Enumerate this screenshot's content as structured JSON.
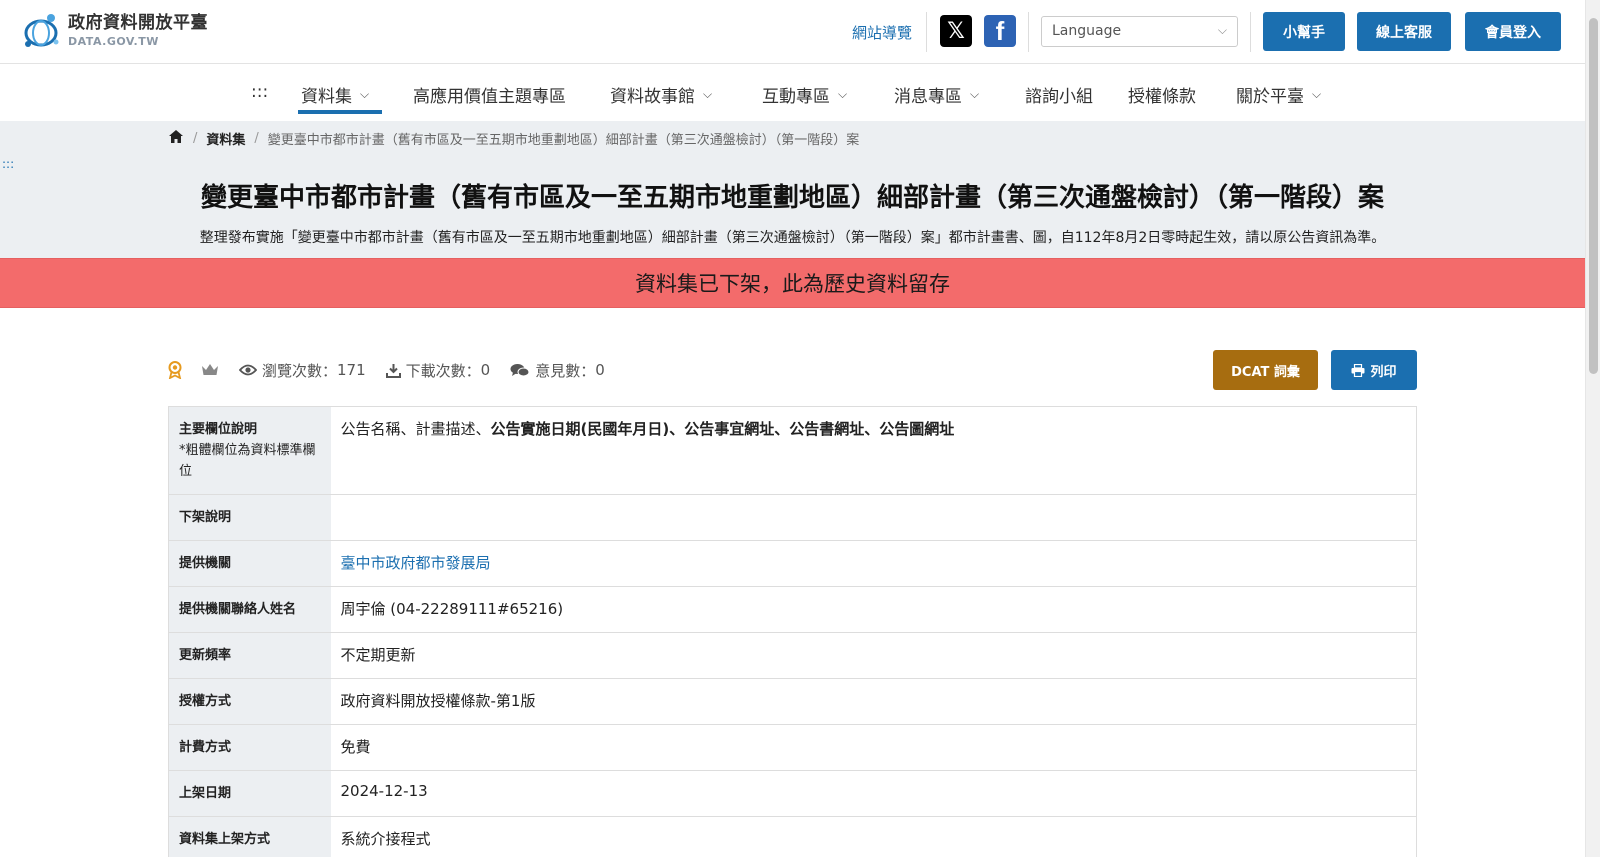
{
  "header": {
    "logo_cn": "政府資料開放平臺",
    "logo_en": "DATA.GOV.TW",
    "sitemap": "網站導覽",
    "language_placeholder": "Language",
    "buttons": {
      "helper": "小幫手",
      "service": "線上客服",
      "login": "會員登入"
    },
    "icons": {
      "x": "x-icon",
      "facebook": "facebook-icon"
    }
  },
  "nav": {
    "dots": ":::",
    "items": [
      {
        "label": "資料集",
        "dropdown": true,
        "active": true
      },
      {
        "label": "高應用價值主題專區",
        "dropdown": false
      },
      {
        "label": "資料故事館",
        "dropdown": true
      },
      {
        "label": "互動專區",
        "dropdown": true
      },
      {
        "label": "消息專區",
        "dropdown": true
      },
      {
        "label": "諮詢小組",
        "dropdown": false
      },
      {
        "label": "授權條款",
        "dropdown": false
      },
      {
        "label": "關於平臺",
        "dropdown": true
      }
    ]
  },
  "breadcrumb": {
    "sep": "/",
    "section": "資料集",
    "current": "變更臺中市都市計畫（舊有市區及一至五期市地重劃地區）細部計畫（第三次通盤檢討）（第一階段）案"
  },
  "skip_dots": ":::",
  "title": "變更臺中市都市計畫（舊有市區及一至五期市地重劃地區）細部計畫（第三次通盤檢討）（第一階段）案",
  "description": "整理發布實施「變更臺中市都市計畫（舊有市區及一至五期市地重劃地區）細部計畫（第三次通盤檢討）（第一階段）案」都市計畫書、圖，自112年8月2日零時起生效，請以原公告資訊為準。",
  "alert": "資料集已下架，此為歷史資料留存",
  "stats": {
    "views_label": "瀏覽次數：",
    "views": "171",
    "downloads_label": "下載次數：",
    "downloads": "0",
    "comments_label": "意見數：",
    "comments": "0"
  },
  "actions": {
    "dcat": "DCAT 詞彙",
    "print": "列印"
  },
  "fields": {
    "main_key": "主要欄位說明",
    "main_note": "*粗體欄位為資料標準欄位",
    "main_plain": "公告名稱、計畫描述、",
    "main_bold": "公告實施日期(民國年月日)、公告事宜網址、公告書網址、公告圖網址",
    "delist_key": "下架說明",
    "delist_value": "",
    "provider_key": "提供機關",
    "provider_value": "臺中市政府都市發展局",
    "contact_key": "提供機關聯絡人姓名",
    "contact_value": "周宇倫 (04-22289111#65216)",
    "frequency_key": "更新頻率",
    "frequency_value": "不定期更新",
    "license_key": "授權方式",
    "license_value": "政府資料開放授權條款-第1版",
    "fee_key": "計費方式",
    "fee_value": "免費",
    "listed_key": "上架日期",
    "listed_value": "2024-12-13",
    "method_key": "資料集上架方式",
    "method_value": "系統介接程式"
  },
  "colors": {
    "brand": "#1b6fb0",
    "alert": "#f36b6b",
    "dcat": "#a76d10",
    "hero_bg": "#eceff2"
  }
}
